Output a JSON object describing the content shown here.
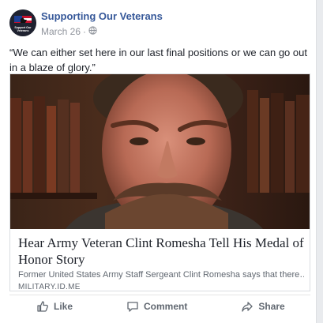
{
  "post": {
    "page_name": "Supporting Our Veterans",
    "avatar_text": "Support Our Veterans",
    "date": "March 26",
    "separator": "·",
    "privacy_icon": "globe-icon",
    "text": "“We can either set here in our last final positions or we can go out in a blaze of glory.”"
  },
  "link": {
    "title": "Hear Army Veteran Clint Romesha Tell His Medal of Honor Story",
    "description": "Former United States Army Staff Sergeant Clint Romesha says that there…",
    "domain": "MILITARY.ID.ME"
  },
  "actions": {
    "like": "Like",
    "comment": "Comment",
    "share": "Share",
    "like_icon": "thumbs-up-icon",
    "comment_icon": "comment-bubble-icon",
    "share_icon": "share-arrow-icon"
  },
  "colors": {
    "page_name": "#365899",
    "meta": "#90949c",
    "action": "#606770"
  }
}
